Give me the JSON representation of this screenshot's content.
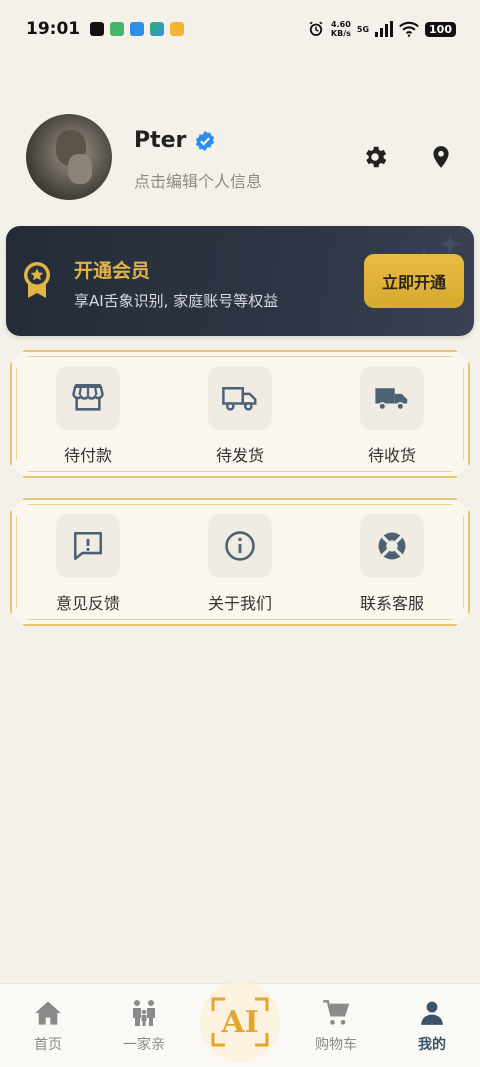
{
  "status_bar": {
    "time": "19:01",
    "net_speed_value": "4.60",
    "net_speed_unit": "KB/s",
    "network": "5G",
    "battery": "100"
  },
  "profile": {
    "name": "Pter",
    "subtitle": "点击编辑个人信息"
  },
  "vip": {
    "title": "开通会员",
    "description": "享AI舌象识别, 家庭账号等权益",
    "button": "立即开通"
  },
  "orders": [
    {
      "label": "待付款",
      "icon": "store-icon"
    },
    {
      "label": "待发货",
      "icon": "truck-outline-icon"
    },
    {
      "label": "待收货",
      "icon": "truck-filled-icon"
    }
  ],
  "services": [
    {
      "label": "意见反馈",
      "icon": "feedback-icon"
    },
    {
      "label": "关于我们",
      "icon": "info-icon"
    },
    {
      "label": "联系客服",
      "icon": "lifebuoy-icon"
    }
  ],
  "nav": {
    "home": "首页",
    "family": "一家亲",
    "ai": "AI",
    "cart": "购物车",
    "mine": "我的"
  },
  "colors": {
    "background": "#f4f1ea",
    "gold": "#e2b445",
    "icon_slate": "#4d6375",
    "vip_dark": "#2a313e"
  }
}
